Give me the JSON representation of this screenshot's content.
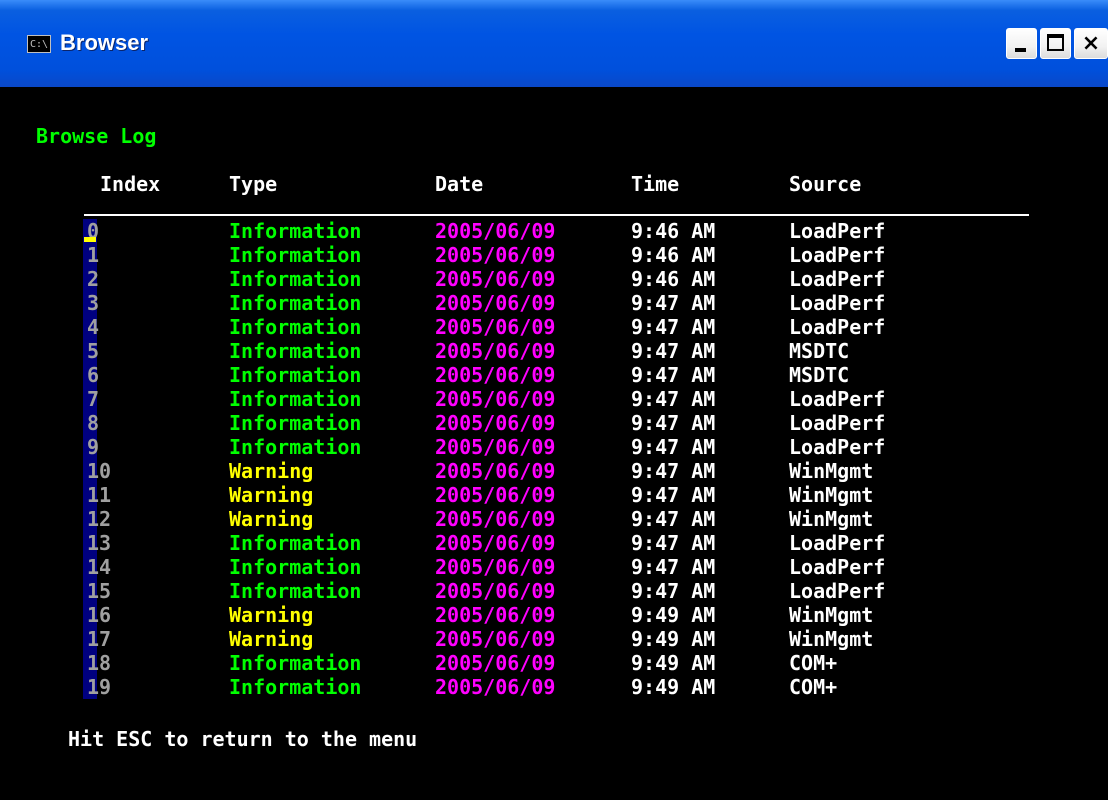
{
  "window": {
    "title": "Browser",
    "icon_glyph": "C:\\",
    "controls": {
      "minimize_icon": "minimize-icon",
      "maximize_icon": "maximize-icon",
      "close_icon": "close-icon",
      "close_glyph": "×"
    }
  },
  "console": {
    "heading": "Browse Log",
    "columns": {
      "index": "Index",
      "type": "Type",
      "date": "Date",
      "time": "Time",
      "source": "Source"
    },
    "rows": [
      {
        "index": "0",
        "type": "Information",
        "date": "2005/06/09",
        "time": "9:46 AM",
        "source": "LoadPerf"
      },
      {
        "index": "1",
        "type": "Information",
        "date": "2005/06/09",
        "time": "9:46 AM",
        "source": "LoadPerf"
      },
      {
        "index": "2",
        "type": "Information",
        "date": "2005/06/09",
        "time": "9:46 AM",
        "source": "LoadPerf"
      },
      {
        "index": "3",
        "type": "Information",
        "date": "2005/06/09",
        "time": "9:47 AM",
        "source": "LoadPerf"
      },
      {
        "index": "4",
        "type": "Information",
        "date": "2005/06/09",
        "time": "9:47 AM",
        "source": "LoadPerf"
      },
      {
        "index": "5",
        "type": "Information",
        "date": "2005/06/09",
        "time": "9:47 AM",
        "source": "MSDTC"
      },
      {
        "index": "6",
        "type": "Information",
        "date": "2005/06/09",
        "time": "9:47 AM",
        "source": "MSDTC"
      },
      {
        "index": "7",
        "type": "Information",
        "date": "2005/06/09",
        "time": "9:47 AM",
        "source": "LoadPerf"
      },
      {
        "index": "8",
        "type": "Information",
        "date": "2005/06/09",
        "time": "9:47 AM",
        "source": "LoadPerf"
      },
      {
        "index": "9",
        "type": "Information",
        "date": "2005/06/09",
        "time": "9:47 AM",
        "source": "LoadPerf"
      },
      {
        "index": "10",
        "type": "Warning",
        "date": "2005/06/09",
        "time": "9:47 AM",
        "source": "WinMgmt"
      },
      {
        "index": "11",
        "type": "Warning",
        "date": "2005/06/09",
        "time": "9:47 AM",
        "source": "WinMgmt"
      },
      {
        "index": "12",
        "type": "Warning",
        "date": "2005/06/09",
        "time": "9:47 AM",
        "source": "WinMgmt"
      },
      {
        "index": "13",
        "type": "Information",
        "date": "2005/06/09",
        "time": "9:47 AM",
        "source": "LoadPerf"
      },
      {
        "index": "14",
        "type": "Information",
        "date": "2005/06/09",
        "time": "9:47 AM",
        "source": "LoadPerf"
      },
      {
        "index": "15",
        "type": "Information",
        "date": "2005/06/09",
        "time": "9:47 AM",
        "source": "LoadPerf"
      },
      {
        "index": "16",
        "type": "Warning",
        "date": "2005/06/09",
        "time": "9:49 AM",
        "source": "WinMgmt"
      },
      {
        "index": "17",
        "type": "Warning",
        "date": "2005/06/09",
        "time": "9:49 AM",
        "source": "WinMgmt"
      },
      {
        "index": "18",
        "type": "Information",
        "date": "2005/06/09",
        "time": "9:49 AM",
        "source": "COM+"
      },
      {
        "index": "19",
        "type": "Information",
        "date": "2005/06/09",
        "time": "9:49 AM",
        "source": "COM+"
      }
    ],
    "footer": "Hit ESC to return to the menu"
  },
  "colors": {
    "heading": "#00ff00",
    "information": "#00ff00",
    "warning": "#ffff00",
    "date": "#ff00ff",
    "index": "#a0a0a0",
    "text": "#ffffff",
    "index_highlight": "#000080",
    "cursor": "#ffff00",
    "titlebar": "#0054e3",
    "background": "#000000"
  }
}
